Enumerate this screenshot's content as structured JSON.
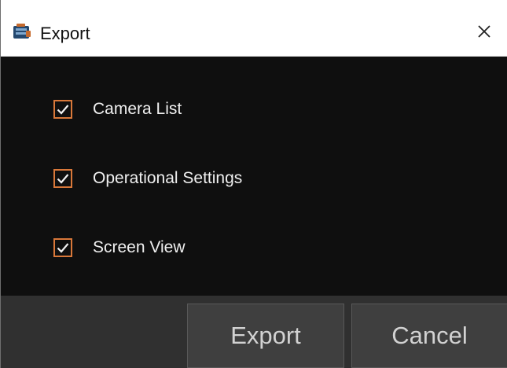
{
  "dialog": {
    "title": "Export",
    "icon": "export-app-icon",
    "close_icon": "close-icon"
  },
  "options": [
    {
      "label": "Camera List",
      "checked": true
    },
    {
      "label": "Operational Settings",
      "checked": true
    },
    {
      "label": "Screen View",
      "checked": true
    }
  ],
  "buttons": {
    "export_label": "Export",
    "cancel_label": "Cancel"
  },
  "colors": {
    "accent": "#d9783a",
    "background": "#0f0f0f",
    "footer": "#303030",
    "button": "#3f3f3f"
  }
}
